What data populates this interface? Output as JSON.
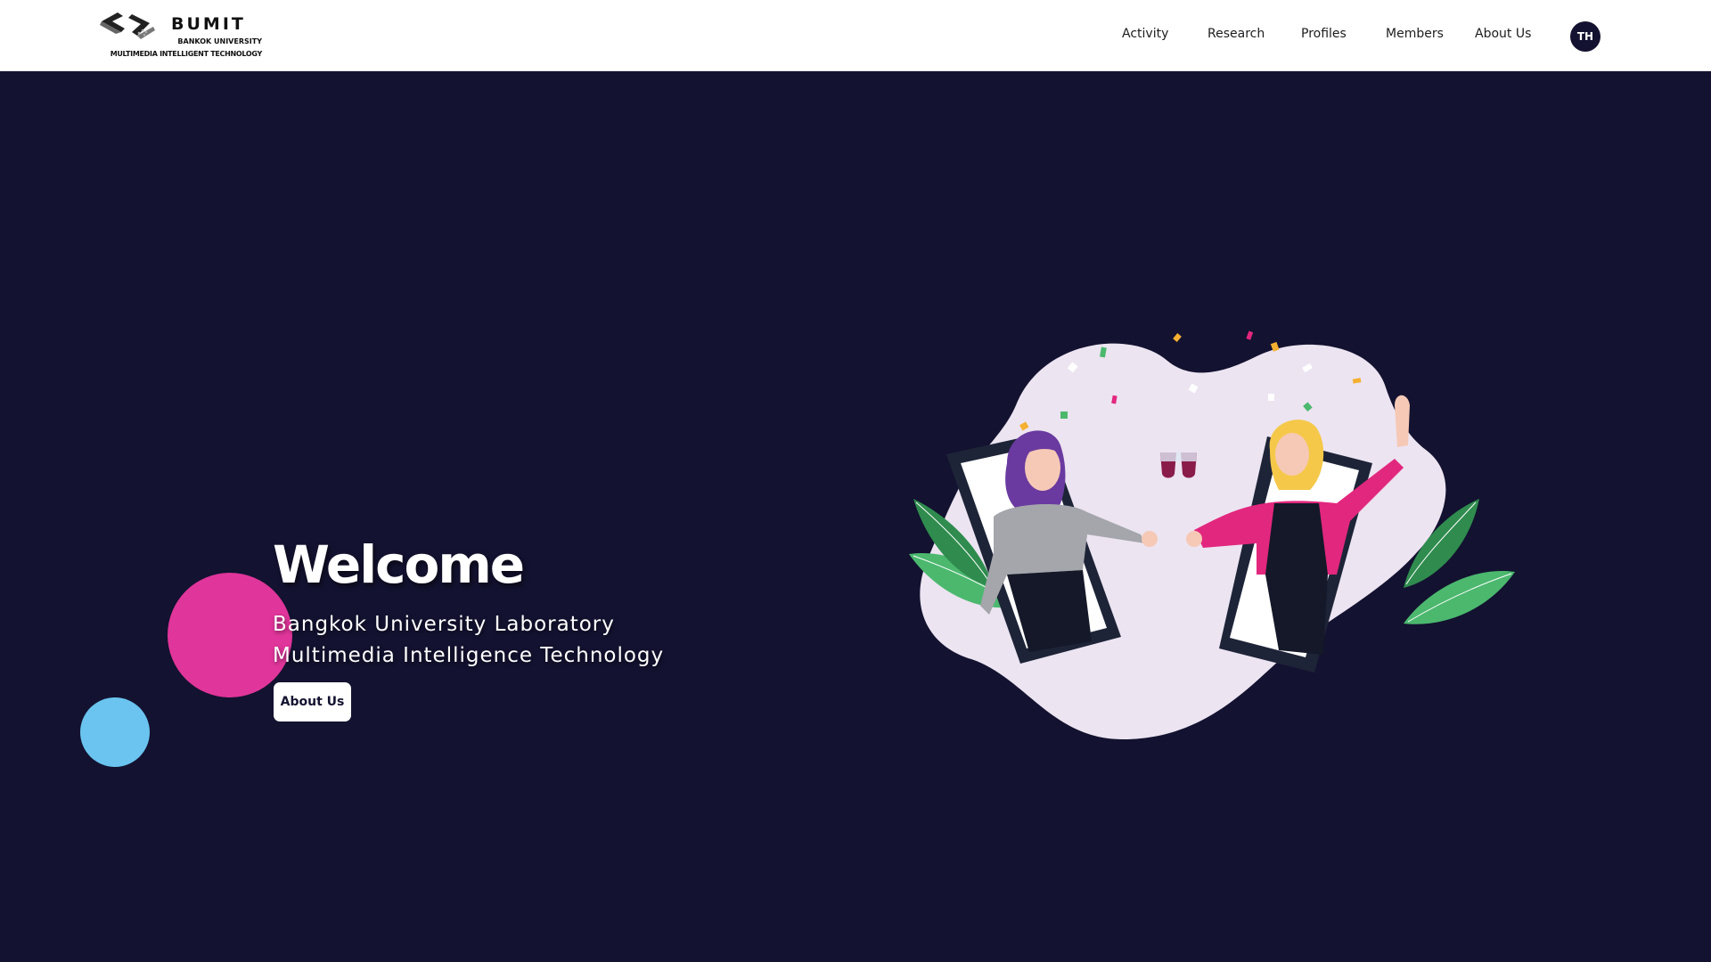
{
  "header": {
    "logo": {
      "title": "BUMIT",
      "subtitle_line1": "BANKOK UNIVERSITY",
      "subtitle_line2": "MULTIMEDIA INTELLIGENT TECHNOLOGY",
      "icon": "bumit-logo-mark"
    },
    "nav": [
      "Activity",
      "Research",
      "Profiles",
      "Members",
      "About Us"
    ],
    "language_button": "TH"
  },
  "hero": {
    "title": "Welcome",
    "line1": "Bangkok University Laboratory",
    "line2": "Multimedia Intelligence Technology",
    "button_label": "About Us",
    "illustration": "two-women-toasting-through-phones-illustration"
  },
  "colors": {
    "background": "#131230",
    "header": "#ffffff",
    "accent_pink": "#e0359a",
    "accent_blue": "#6ac4ef",
    "blob": "#ece4f1",
    "leaf_green": "#4bb86e"
  }
}
